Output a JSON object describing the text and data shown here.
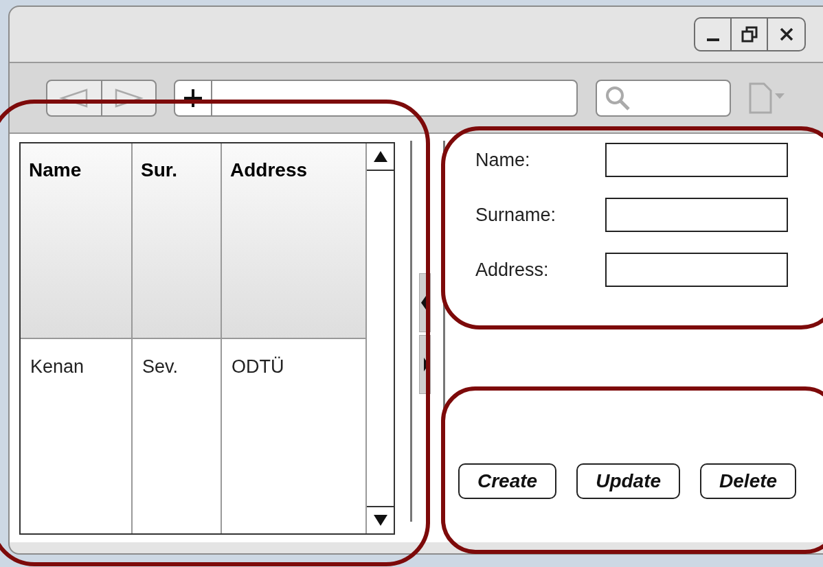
{
  "table": {
    "columns": [
      "Name",
      "Sur.",
      "Address"
    ],
    "rows": [
      [
        "Kenan",
        "Sev.",
        "ODTÜ"
      ]
    ]
  },
  "form": {
    "fields": [
      {
        "label": "Name:"
      },
      {
        "label": "Surname:"
      },
      {
        "label": "Address:"
      }
    ]
  },
  "buttons": [
    "Create",
    "Update",
    "Delete"
  ]
}
